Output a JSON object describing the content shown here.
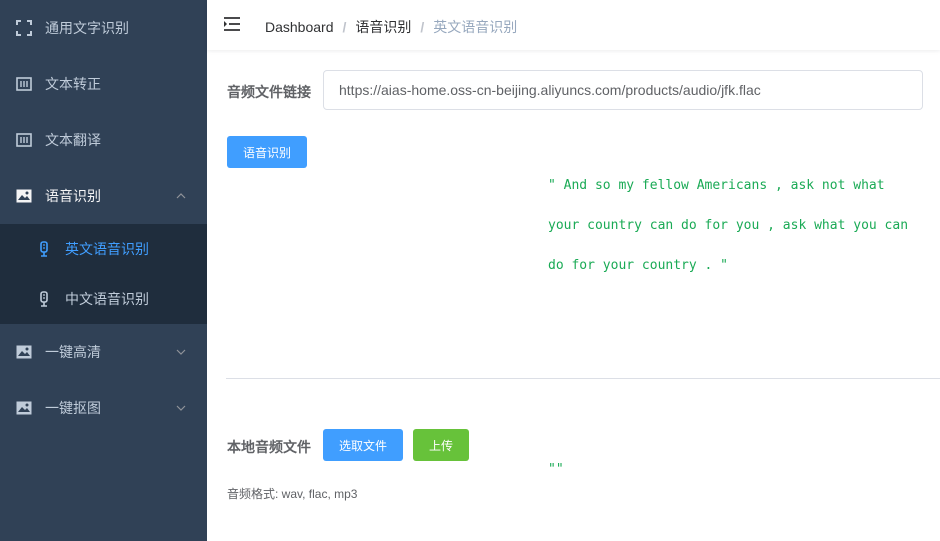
{
  "sidebar": {
    "items": [
      {
        "label": "通用文字识别",
        "icon": "scan-icon"
      },
      {
        "label": "文本转正",
        "icon": "text-doc-icon"
      },
      {
        "label": "文本翻译",
        "icon": "text-doc-icon"
      },
      {
        "label": "语音识别",
        "icon": "image-icon",
        "expanded": true
      },
      {
        "label": "一键高清",
        "icon": "image-icon"
      },
      {
        "label": "一键抠图",
        "icon": "image-icon"
      }
    ],
    "subitems": [
      {
        "label": "英文语音识别",
        "icon": "microphone-icon",
        "active": true
      },
      {
        "label": "中文语音识别",
        "icon": "microphone-icon"
      }
    ]
  },
  "breadcrumb": {
    "home": "Dashboard",
    "parent": "语音识别",
    "current": "英文语音识别",
    "separator": "/"
  },
  "form": {
    "url_label": "音频文件链接",
    "url_value": "https://aias-home.oss-cn-beijing.aliyuncs.com/products/audio/jfk.flac",
    "recognize_button": "语音识别",
    "result_text": "\" And so my fellow Americans , ask not what your country can do for you , ask what you can do for your country . \"",
    "local_label": "本地音频文件",
    "select_file_button": "选取文件",
    "upload_button": "上传",
    "local_result": "\"\"",
    "format_hint": "音频格式: wav, flac, mp3"
  },
  "colors": {
    "sidebar_bg": "#304156",
    "submenu_bg": "#1f2d3d",
    "active": "#409eff",
    "result_text": "#1aaa55",
    "success": "#67c23a"
  }
}
